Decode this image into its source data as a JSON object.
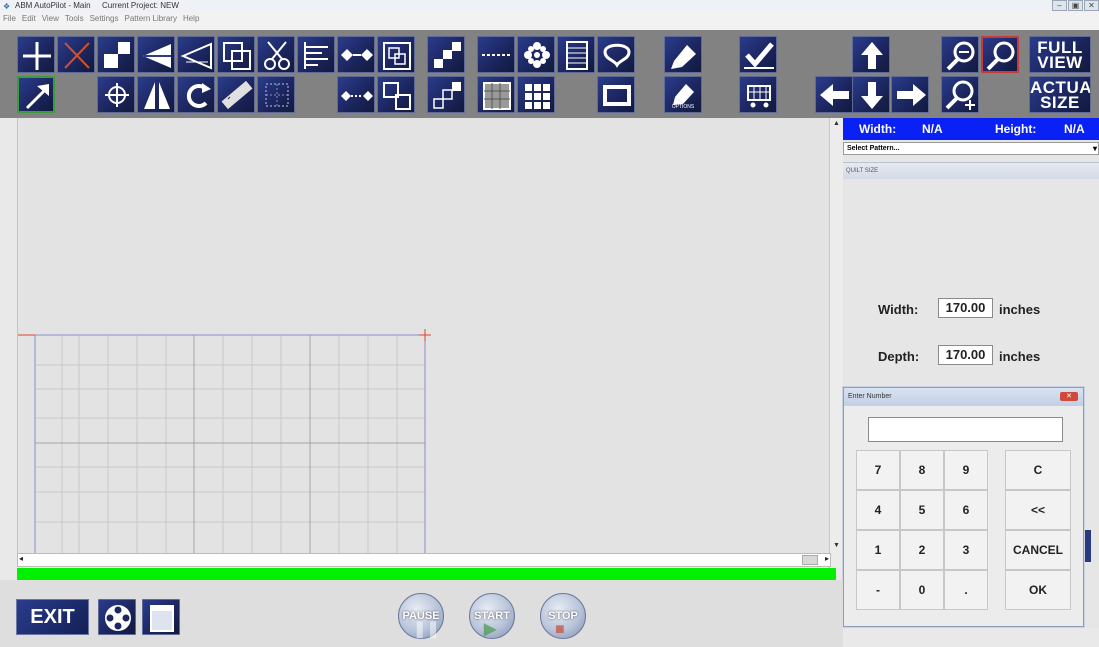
{
  "window": {
    "title": "ABM AutoPilot - Main",
    "project": "Current Project: NEW"
  },
  "menu": [
    "File",
    "Edit",
    "View",
    "Tools",
    "Settings",
    "Pattern Library",
    "Help"
  ],
  "toolbar": {
    "full_view_line1": "FULL",
    "full_view_line2": "VIEW",
    "actual_size_line1": "ACTUAL",
    "actual_size_line2": "SIZE",
    "options_label": "OPTIONS"
  },
  "dimensions": {
    "width_label": "Width:",
    "width_value": "N/A",
    "height_label": "Height:",
    "height_value": "N/A"
  },
  "pattern_select": {
    "value": "Select Pattern..."
  },
  "quilt_size": {
    "header": "QUILT SIZE",
    "width_label": "Width:",
    "width_value": "170.00",
    "width_unit": "inches",
    "depth_label": "Depth:",
    "depth_value": "170.00",
    "depth_unit": "inches"
  },
  "dialog": {
    "title": "Enter Number",
    "close_glyph": "✕",
    "input_value": "",
    "keys": [
      "7",
      "8",
      "9",
      "4",
      "5",
      "6",
      "1",
      "2",
      "3",
      "-",
      "0",
      "."
    ],
    "clear": "C",
    "backspace": "<<",
    "cancel": "CANCEL",
    "ok": "OK"
  },
  "bottom": {
    "exit": "EXIT",
    "pause": "PAUSE",
    "start": "START",
    "stop": "STOP"
  },
  "colors": {
    "dim_bar": "#0a21f5",
    "progress": "#00f000",
    "toolbar_bg": "#828282",
    "grid_line": "#8a8fc8",
    "marker": "#e0402a"
  }
}
